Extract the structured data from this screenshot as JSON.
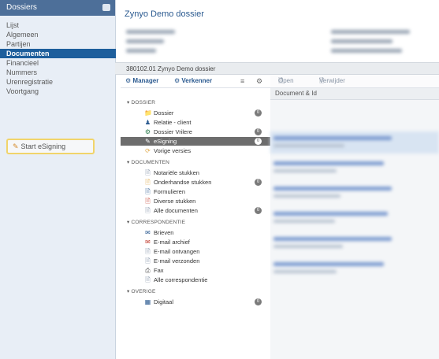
{
  "sidebar": {
    "header": "Dossiers",
    "items": [
      {
        "label": "Lijst"
      },
      {
        "label": "Algemeen"
      },
      {
        "label": "Partijen"
      },
      {
        "label": "Documenten",
        "active": true
      },
      {
        "label": "Financieel"
      },
      {
        "label": "Nummers"
      },
      {
        "label": "Urenregistratie"
      },
      {
        "label": "Voortgang"
      }
    ],
    "start_flow": "Start eSigning"
  },
  "header": {
    "title": "Zynyo Demo dossier"
  },
  "breadcrumb": "380102.01 Zynyo Demo dossier",
  "tree_toolbar": {
    "manager": "Manager",
    "verkenner": "Verkenner",
    "icons": [
      "list-icon",
      "settings-icon"
    ]
  },
  "tree": {
    "sections": [
      {
        "label": "DOSSIER",
        "nodes": [
          {
            "label": "Dossier",
            "icon": "folder-icon",
            "badge": "0"
          },
          {
            "label": "Relatie - client",
            "icon": "person-icon"
          },
          {
            "label": "Dossier Vrilere",
            "icon": "gear-icon",
            "badge": "0"
          },
          {
            "label": "eSigning",
            "icon": "esign-icon",
            "badge": "0",
            "selected": true
          },
          {
            "label": "Vorige versies",
            "icon": "history-icon"
          }
        ]
      },
      {
        "label": "DOCUMENTEN",
        "nodes": [
          {
            "label": "Notariële stukken",
            "icon": "doc-icon"
          },
          {
            "label": "Onderhandse stukken",
            "icon": "doc-icon",
            "badge": "0"
          },
          {
            "label": "Formulieren",
            "icon": "form-icon"
          },
          {
            "label": "Diverse stukken",
            "icon": "doc-icon"
          },
          {
            "label": "Alle documenten",
            "icon": "doc-icon",
            "badge": "0"
          }
        ]
      },
      {
        "label": "CORRESPONDENTIE",
        "nodes": [
          {
            "label": "Brieven",
            "icon": "letter-icon"
          },
          {
            "label": "E-mail archief",
            "icon": "mail-icon"
          },
          {
            "label": "E-mail ontvangen",
            "icon": "mail-in-icon"
          },
          {
            "label": "E-mail verzonden",
            "icon": "mail-out-icon"
          },
          {
            "label": "Fax",
            "icon": "fax-icon"
          },
          {
            "label": "Alle correspondentie",
            "icon": "doc-icon"
          }
        ]
      },
      {
        "label": "OVERIGE",
        "nodes": [
          {
            "label": "Digitaal",
            "icon": "digital-icon",
            "badge": "0"
          }
        ]
      }
    ]
  },
  "doc_toolbar": {
    "open": "Open",
    "verwijder": "Verwijder"
  },
  "doc_list": {
    "column_header": "Document & Id"
  },
  "colors": {
    "sidebar_header": "#4d6f99",
    "sidebar_active": "#1d5e9c",
    "highlight_border": "#f1d46a",
    "selected_node": "#6d6d6d",
    "title": "#2b5a90"
  }
}
